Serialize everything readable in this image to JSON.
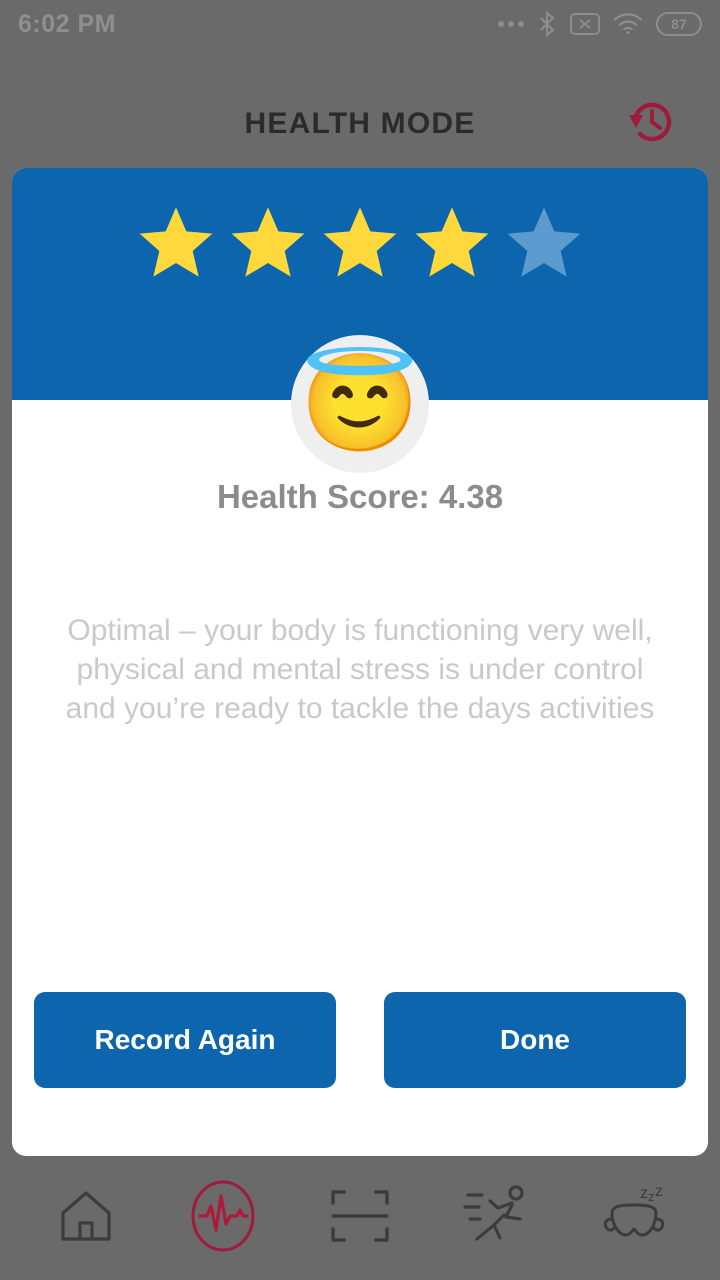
{
  "status_bar": {
    "time": "6:02 PM",
    "icons": [
      "more-dots-icon",
      "bluetooth-icon",
      "no-sim-icon",
      "wifi-icon",
      "battery-icon"
    ],
    "battery_level": "87"
  },
  "app_bar": {
    "title": "HEALTH MODE",
    "history_icon": "history-clock-icon",
    "history_color": "#9e1b3c"
  },
  "card": {
    "header_color": "#0d65ad",
    "rating": {
      "filled": 4,
      "total": 5,
      "filled_color": "#ffd93b",
      "empty_color": "#5b9bd0"
    },
    "emoji": "😇",
    "emoji_name": "smiling-face-with-halo",
    "score_label": "Health Score: 4.38",
    "description": "Optimal – your body is functioning very well, physical and mental stress is under control and you’re ready to tackle the days activities",
    "buttons": {
      "record_again": "Record Again",
      "done": "Done"
    }
  },
  "bottom_nav": {
    "active_color": "#9e1b3c",
    "inactive_color": "#3c3c3c",
    "items": [
      {
        "name": "home",
        "icon": "home-icon",
        "active": false
      },
      {
        "name": "health",
        "icon": "pulse-heartbeat-icon",
        "active": true
      },
      {
        "name": "scan",
        "icon": "scan-frame-icon",
        "active": false
      },
      {
        "name": "activity",
        "icon": "running-person-icon",
        "active": false
      },
      {
        "name": "sleep",
        "icon": "sleep-mask-icon",
        "active": false
      }
    ]
  }
}
